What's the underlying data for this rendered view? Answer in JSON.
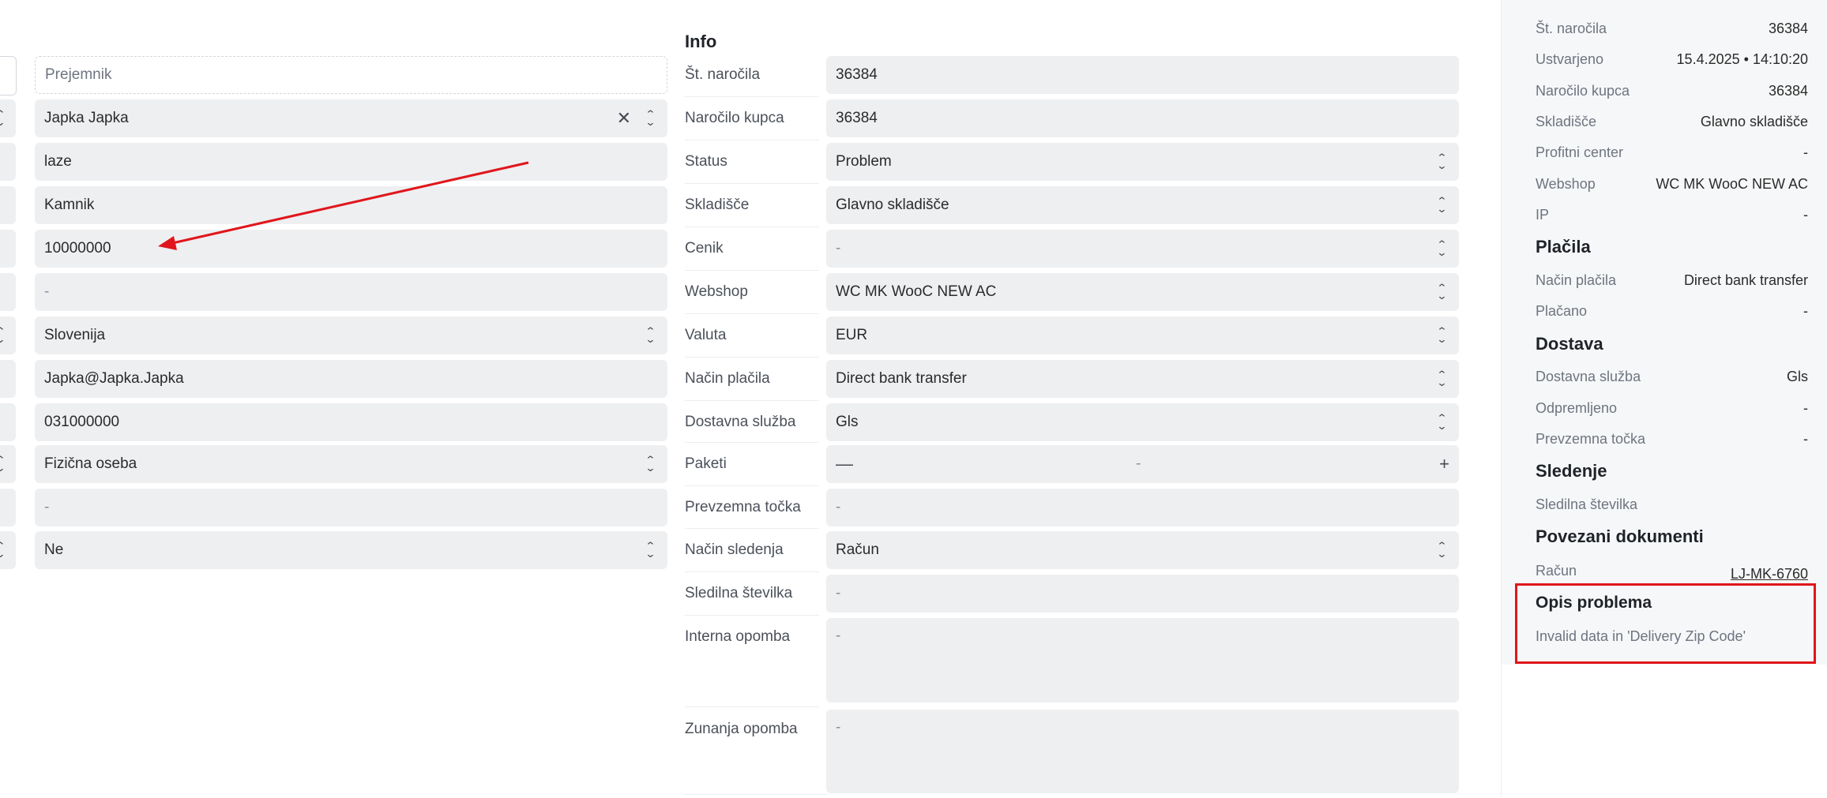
{
  "recipient": {
    "header_placeholder": "Prejemnik",
    "name": "Japka Japka",
    "address": "laze",
    "city": "Kamnik",
    "zip": "10000000",
    "field5": "-",
    "country": "Slovenija",
    "email": "Japka@Japka.Japka",
    "phone": "031000000",
    "customer_type": "Fizična oseba",
    "field11": "-",
    "field12": "Ne"
  },
  "info": {
    "title": "Info",
    "rows": [
      {
        "label": "Št. naročila",
        "value": "36384"
      },
      {
        "label": "Naročilo kupca",
        "value": "36384"
      },
      {
        "label": "Status",
        "value": "Problem"
      },
      {
        "label": "Skladišče",
        "value": "Glavno skladišče"
      },
      {
        "label": "Cenik",
        "value": "-"
      },
      {
        "label": "Webshop",
        "value": "WC MK WooC NEW AC"
      },
      {
        "label": "Valuta",
        "value": "EUR"
      },
      {
        "label": "Način plačila",
        "value": "Direct bank transfer"
      },
      {
        "label": "Dostavna služba",
        "value": "Gls"
      },
      {
        "label": "Paketi",
        "minus": "—",
        "value": "-",
        "plus": "+"
      },
      {
        "label": "Prevzemna točka",
        "value": "-"
      },
      {
        "label": "Način sledenja",
        "value": "Račun"
      },
      {
        "label": "Sledilna številka",
        "value": "-"
      },
      {
        "label": "Interna opomba",
        "value": "-"
      },
      {
        "label": "Zunanja opomba",
        "value": "-"
      }
    ]
  },
  "panel": {
    "order": [
      {
        "label": "Št. naročila",
        "value": "36384"
      },
      {
        "label": "Ustvarjeno",
        "value": "15.4.2025 • 14:10:20"
      },
      {
        "label": "Naročilo kupca",
        "value": "36384"
      },
      {
        "label": "Skladišče",
        "value": "Glavno skladišče"
      },
      {
        "label": "Profitni center",
        "value": "-"
      },
      {
        "label": "Webshop",
        "value": "WC MK WooC NEW AC"
      },
      {
        "label": "IP",
        "value": "-"
      }
    ],
    "payments_title": "Plačila",
    "payments": [
      {
        "label": "Način plačila",
        "value": "Direct bank transfer"
      },
      {
        "label": "Plačano",
        "value": "-"
      }
    ],
    "delivery_title": "Dostava",
    "delivery": [
      {
        "label": "Dostavna služba",
        "value": "Gls"
      },
      {
        "label": "Odpremljeno",
        "value": "-"
      },
      {
        "label": "Prevzemna točka",
        "value": "-"
      }
    ],
    "tracking_title": "Sledenje",
    "tracking_label": "Sledilna številka",
    "docs_title": "Povezani dokumenti",
    "invoice_label": "Račun",
    "invoice_link": "LJ-MK-6760",
    "problem_title": "Opis problema",
    "problem_text": "Invalid data in 'Delivery Zip Code'"
  },
  "colors": {
    "annotation": "#e0161c",
    "field_bg": "#eeeff1",
    "panel_bg": "#f6f7f8"
  }
}
